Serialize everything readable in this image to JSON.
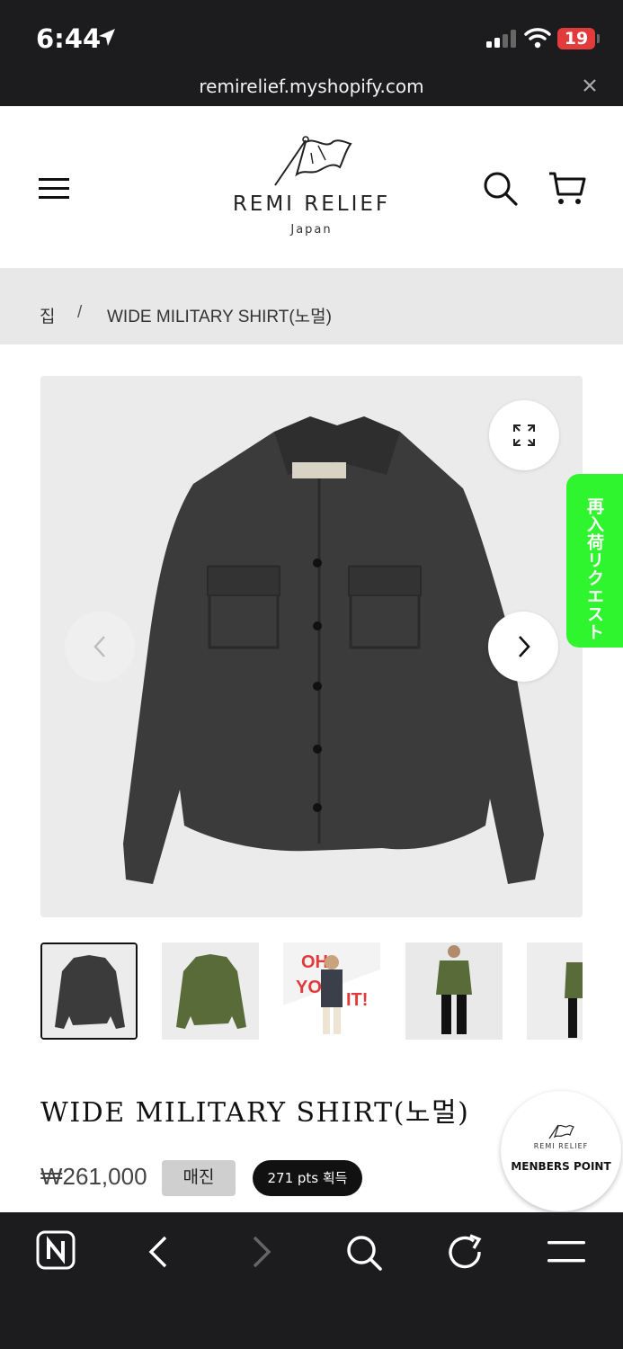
{
  "status_bar": {
    "time": "6:44",
    "battery": "19",
    "url": "remirelief.myshopify.com"
  },
  "header": {
    "brand": "REMI RELIEF",
    "brand_sub": "Japan",
    "icons": [
      "menu-icon",
      "search-icon",
      "cart-icon"
    ]
  },
  "breadcrumb": {
    "home": "집",
    "separator": "/",
    "current": "WIDE MILITARY SHIRT(노멀)"
  },
  "gallery": {
    "restock_label": "再入荷リクエスト",
    "thumbnail_count": 5,
    "active_thumbnail": 1,
    "thumbnail_text_3": "OH YOU HIT!"
  },
  "product": {
    "title": "WIDE MILITARY SHIRT(노멀)",
    "price": "₩261,000",
    "sold_out": "매진",
    "points": "271 pts 획득"
  },
  "members_badge": {
    "brand": "REMI RELIEF",
    "label": "MENBERS POINT"
  },
  "colors": {
    "status_bg": "#1c1c1e",
    "breadcrumb_bg": "#e8e8e8",
    "restock_green": "#2ff52f",
    "badge_gray": "#cfcfcf",
    "points_black": "#111111"
  }
}
